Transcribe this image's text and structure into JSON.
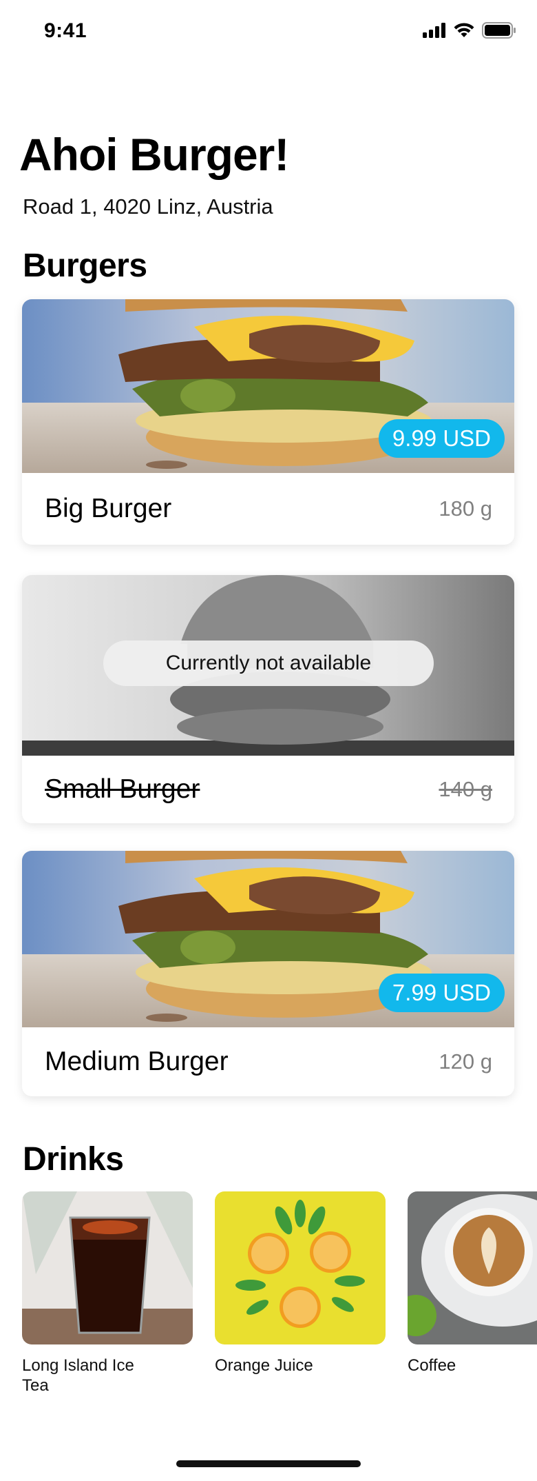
{
  "status_bar": {
    "time": "9:41"
  },
  "restaurant": {
    "name": "Ahoi Burger!",
    "address": "Road 1, 4020 Linz, Austria"
  },
  "sections": {
    "burgers": "Burgers",
    "drinks": "Drinks"
  },
  "burgers": [
    {
      "name": "Big Burger",
      "weight": "180 g",
      "price": "9.99 USD",
      "available": true
    },
    {
      "name": "Small Burger",
      "weight": "140 g",
      "status": "Currently not available",
      "available": false
    },
    {
      "name": "Medium Burger",
      "weight": "120 g",
      "price": "7.99 USD",
      "available": true
    }
  ],
  "drinks": [
    {
      "name": "Long Island Ice Tea"
    },
    {
      "name": "Orange Juice"
    },
    {
      "name": "Coffee"
    }
  ],
  "colors": {
    "accent": "#12b8ec",
    "muted_text": "#808080"
  }
}
